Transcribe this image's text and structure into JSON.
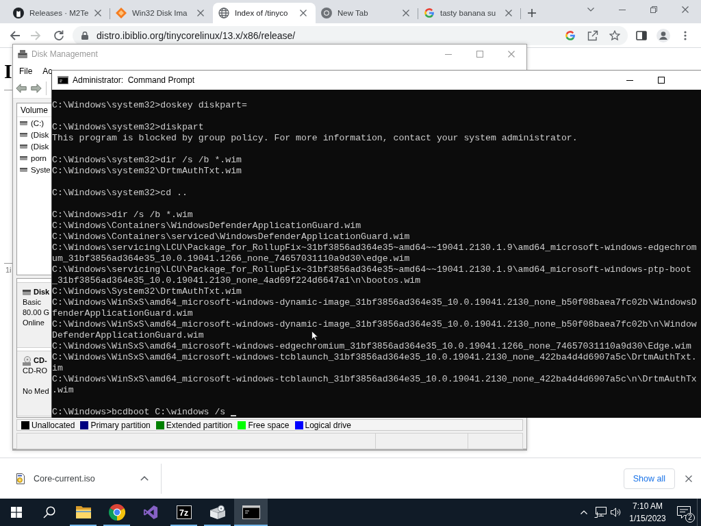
{
  "browser": {
    "tabs": [
      {
        "kind": "cat",
        "title": "Releases · M2Te",
        "selected": false
      },
      {
        "kind": "diamond",
        "title": "Win32 Disk Ima",
        "selected": false
      },
      {
        "kind": "globe",
        "title": "Index of /tinyco",
        "selected": true
      },
      {
        "kind": "ring",
        "title": "New Tab",
        "selected": false
      },
      {
        "kind": "g",
        "title": "tasty banana su",
        "selected": false
      }
    ],
    "nav_buttons": [
      {
        "kind": "back",
        "disabled": false
      },
      {
        "kind": "forward",
        "disabled": true
      },
      {
        "kind": "reload",
        "disabled": false
      }
    ],
    "address": {
      "url": "distro.ibiblio.org/tinycorelinux/13.x/x86/release/"
    }
  },
  "page": {
    "heading": "I",
    "fragment": "1i"
  },
  "disk_management": {
    "title": "Disk Management",
    "focused": false,
    "menu": [
      "File",
      "Ac"
    ],
    "volume_column": "Volume",
    "volumes": [
      "(C:)",
      "(Disk",
      "(Disk",
      "porn",
      "Syste"
    ],
    "disks": [
      {
        "kind": "disk",
        "name": "Disk",
        "type": "Basic",
        "size": "80.00 G",
        "status": "Online"
      },
      {
        "kind": "cdrom",
        "name": "CD-",
        "type": "CD-RO",
        "status": "No Med"
      }
    ],
    "legend": [
      {
        "label": "Unallocated",
        "color": "#000000"
      },
      {
        "label": "Primary partition",
        "color": "#000080"
      },
      {
        "label": "Extended partition",
        "color": "#008000"
      },
      {
        "label": "Free space",
        "color": "#00ff00"
      },
      {
        "label": "Logical drive",
        "color": "#0000ff"
      }
    ]
  },
  "command_prompt": {
    "title": "Administrator:  Command Prompt",
    "focused": true,
    "cursor": true,
    "blocks": [
      {
        "lines": [
          "C:\\Windows\\system32>doskey diskpart="
        ]
      },
      {
        "lines": [
          "C:\\Windows\\system32>diskpart",
          "This program is blocked by group policy. For more information, contact your system administrator."
        ]
      },
      {
        "lines": [
          "C:\\Windows\\system32>dir /s /b *.wim",
          "C:\\Windows\\system32\\DrtmAuthTxt.wim"
        ]
      },
      {
        "lines": [
          "C:\\Windows\\system32>cd .."
        ]
      },
      {
        "lines": [
          "C:\\Windows>dir /s /b *.wim",
          "C:\\Windows\\Containers\\WindowsDefenderApplicationGuard.wim",
          "C:\\Windows\\Containers\\serviced\\WindowsDefenderApplicationGuard.wim",
          "C:\\Windows\\servicing\\LCU\\Package_for_RollupFix~31bf3856ad364e35~amd64~~19041.2130.1.9\\amd64_microsoft-windows-edgechrom",
          "um_31bf3856ad364e35_10.0.19041.1266_none_74657031110a9d30\\edge.wim",
          "C:\\Windows\\servicing\\LCU\\Package_for_RollupFix~31bf3856ad364e35~amd64~~19041.2130.1.9\\amd64_microsoft-windows-ptp-boot",
          "_31bf3856ad364e35_10.0.19041.2130_none_4ad69f224d6647a1\\n\\bootos.wim",
          "C:\\Windows\\System32\\DrtmAuthTxt.wim",
          "C:\\Windows\\WinSxS\\amd64_microsoft-windows-dynamic-image_31bf3856ad364e35_10.0.19041.2130_none_b50f08baea7fc02b\\WindowsD",
          "fenderApplicationGuard.wim",
          "C:\\Windows\\WinSxS\\amd64_microsoft-windows-dynamic-image_31bf3856ad364e35_10.0.19041.2130_none_b50f08baea7fc02b\\n\\Window",
          "DefenderApplicationGuard.wim",
          "C:\\Windows\\WinSxS\\amd64_microsoft-windows-edgechromium_31bf3856ad364e35_10.0.19041.1266_none_74657031110a9d30\\Edge.wim",
          "C:\\Windows\\WinSxS\\amd64_microsoft-windows-tcblaunch_31bf3856ad364e35_10.0.19041.2130_none_422ba4d4d6907a5c\\DrtmAuthTxt.",
          "im",
          "C:\\Windows\\WinSxS\\amd64_microsoft-windows-tcblaunch_31bf3856ad364e35_10.0.19041.2130_none_422ba4d4d6907a5c\\n\\DrtmAuthTx",
          ".wim"
        ]
      },
      {
        "lines": [
          "C:\\Windows>bcdboot C:\\windows /s"
        ]
      }
    ]
  },
  "downloads": {
    "items": [
      {
        "name": "Core-current.iso"
      }
    ],
    "show_all": "Show all"
  },
  "taskbar": {
    "apps": [
      {
        "kind": "folder",
        "running": true,
        "selected": false
      },
      {
        "kind": "ring",
        "running": true,
        "selected": false
      },
      {
        "kind": "ribbon",
        "running": false,
        "selected": false
      },
      {
        "kind": "archiver",
        "label": "7z",
        "running": true,
        "selected": false
      },
      {
        "kind": "package",
        "running": true,
        "selected": false
      },
      {
        "kind": "terminal",
        "running": true,
        "selected": true
      }
    ],
    "time": "7:10 AM",
    "date": "1/15/2023",
    "notifications": "2"
  }
}
